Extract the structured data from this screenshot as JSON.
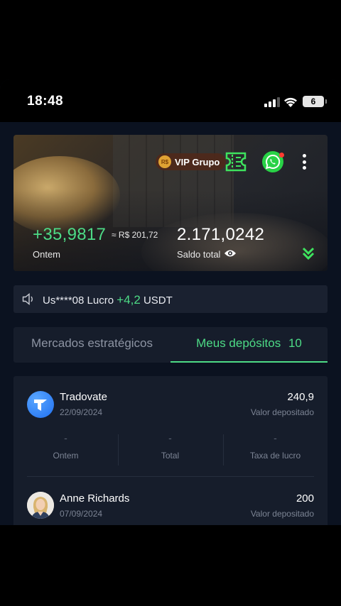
{
  "status_bar": {
    "time": "18:48",
    "battery": "6"
  },
  "hero": {
    "vip_badge_coin": "R$",
    "vip_label": "VIP Grupo",
    "profit_value": "+35,9817",
    "profit_brl": "≈ R$ 201,72",
    "profit_label": "Ontem",
    "balance_value": "2.171,0242",
    "balance_label": "Saldo total",
    "icons": [
      "ticket-icon",
      "whatsapp-icon",
      "more-icon",
      "eye-icon",
      "chevrons-down-icon"
    ]
  },
  "notice": {
    "user": "Us****08 Lucro",
    "amount": "+4,2",
    "currency": "USDT"
  },
  "tabs": {
    "strategic": "Mercados estratégicos",
    "deposits": "Meus depósitos",
    "deposits_count": "10"
  },
  "deposits": [
    {
      "name": "Tradovate",
      "date": "22/09/2024",
      "amount": "240,9",
      "amount_label": "Valor depositado",
      "stats": [
        {
          "value": "-",
          "label": "Ontem"
        },
        {
          "value": "-",
          "label": "Total"
        },
        {
          "value": "-",
          "label": "Taxa de lucro"
        }
      ]
    },
    {
      "name": "Anne Richards",
      "date": "07/09/2024",
      "amount": "200",
      "amount_label": "Valor depositado"
    }
  ],
  "colors": {
    "accent_green": "#4ddb86",
    "background": "#0b1220",
    "card": "#161d2b",
    "whatsapp": "#28d246"
  }
}
